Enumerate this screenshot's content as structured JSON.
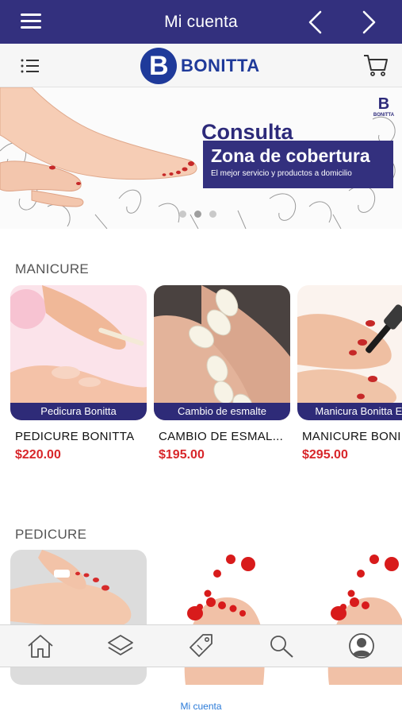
{
  "header": {
    "title": "Mi cuenta",
    "menu_icon": "hamburger-icon",
    "back_icon": "chevron-left-icon",
    "forward_icon": "chevron-right-icon"
  },
  "brand": {
    "logo_letter": "B",
    "logo_text": "BONITTA",
    "list_icon": "list-icon",
    "cart_icon": "cart-icon"
  },
  "banner": {
    "mini_logo_letter": "B",
    "mini_logo_text": "BONITTA",
    "heading": "Consulta",
    "title": "Zona de cobertura",
    "subtitle": "El mejor servicio y productos a domicilio",
    "dots": 3,
    "active_dot": 2
  },
  "sections": [
    {
      "title": "MANICURE",
      "items": [
        {
          "caption": "Pedicura Bonitta",
          "name": "PEDICURE BONITTA",
          "price": "$220.00"
        },
        {
          "caption": "Cambio de esmalte",
          "name": "CAMBIO DE ESMAL...",
          "price": "$195.00"
        },
        {
          "caption": "Manicura Bonitta Esm",
          "name": "MANICURE BONI",
          "price": "$295.00"
        }
      ]
    },
    {
      "title": "PEDICURE",
      "items": []
    }
  ],
  "tabbar": {
    "tabs": [
      "home-icon",
      "layers-icon",
      "tag-icon",
      "search-icon",
      "profile-icon"
    ]
  },
  "footer": {
    "label": "Mi cuenta"
  },
  "colors": {
    "primary": "#33307e",
    "price": "#d8262a",
    "link": "#2a7ad8"
  }
}
